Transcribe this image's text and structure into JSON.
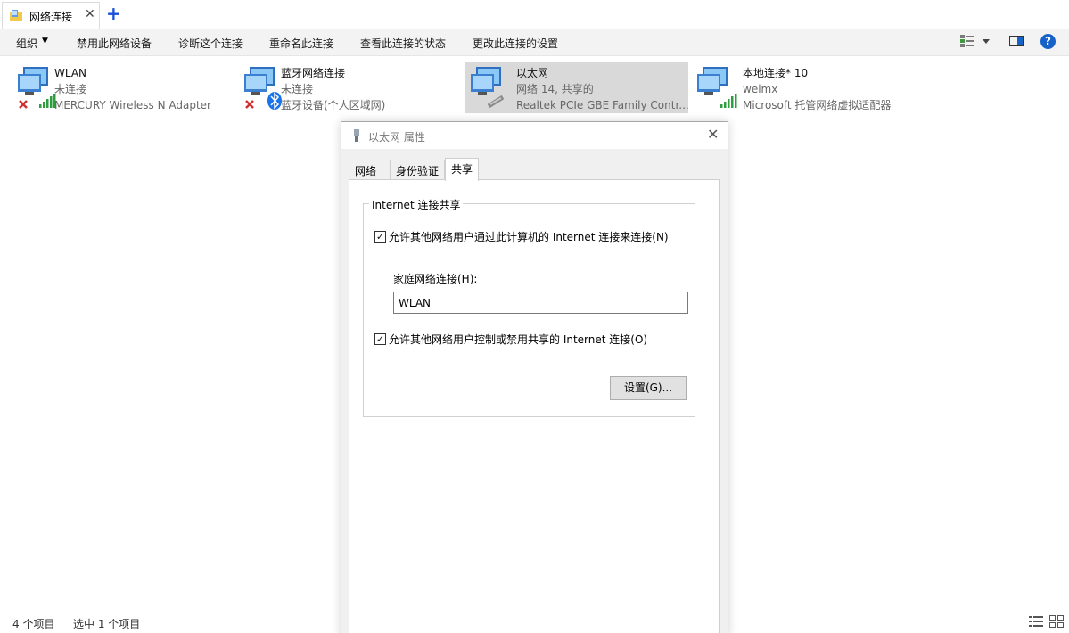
{
  "tab": {
    "title": "网络连接",
    "close_glyph": "✕",
    "new_glyph": "+"
  },
  "toolbar": {
    "organize": "组织",
    "organize_caret": "▼",
    "disable": "禁用此网络设备",
    "diagnose": "诊断这个连接",
    "rename": "重命名此连接",
    "view_status": "查看此连接的状态",
    "change_settings": "更改此连接的设置",
    "help_glyph": "?"
  },
  "connections": [
    {
      "name": "WLAN",
      "status": "未连接",
      "adapter": "MERCURY Wireless N Adapter"
    },
    {
      "name": "蓝牙网络连接",
      "status": "未连接",
      "adapter": "蓝牙设备(个人区域网)"
    },
    {
      "name": "以太网",
      "status": "网络 14, 共享的",
      "adapter": "Realtek PCIe GBE Family Contr..."
    },
    {
      "name": "本地连接* 10",
      "status": "weimx",
      "adapter": "Microsoft 托管网络虚拟适配器"
    }
  ],
  "dialog": {
    "title": "以太网 属性",
    "close_glyph": "✕",
    "tabs": [
      "网络",
      "身份验证",
      "共享"
    ],
    "group_title": "Internet 连接共享",
    "allow_share_label": "允许其他网络用户通过此计算机的 Internet 连接来连接(N)",
    "allow_share_checked": true,
    "home_network_label": "家庭网络连接(H):",
    "home_network_value": "WLAN",
    "allow_control_label": "允许其他网络用户控制或禁用共享的 Internet 连接(O)",
    "allow_control_checked": true,
    "settings_button": "设置(G)...",
    "check_glyph": "✓"
  },
  "status": {
    "items_count": "4 个项目",
    "selected_count": "选中 1 个项目"
  },
  "colors": {
    "accent": "#1762c8",
    "selected_bg": "#d9d9d9",
    "toolbar_bg": "#f3f3f3",
    "error_red": "#d32f2f",
    "signal_green": "#2e9e3e",
    "bluetooth": "#1a73e8"
  }
}
